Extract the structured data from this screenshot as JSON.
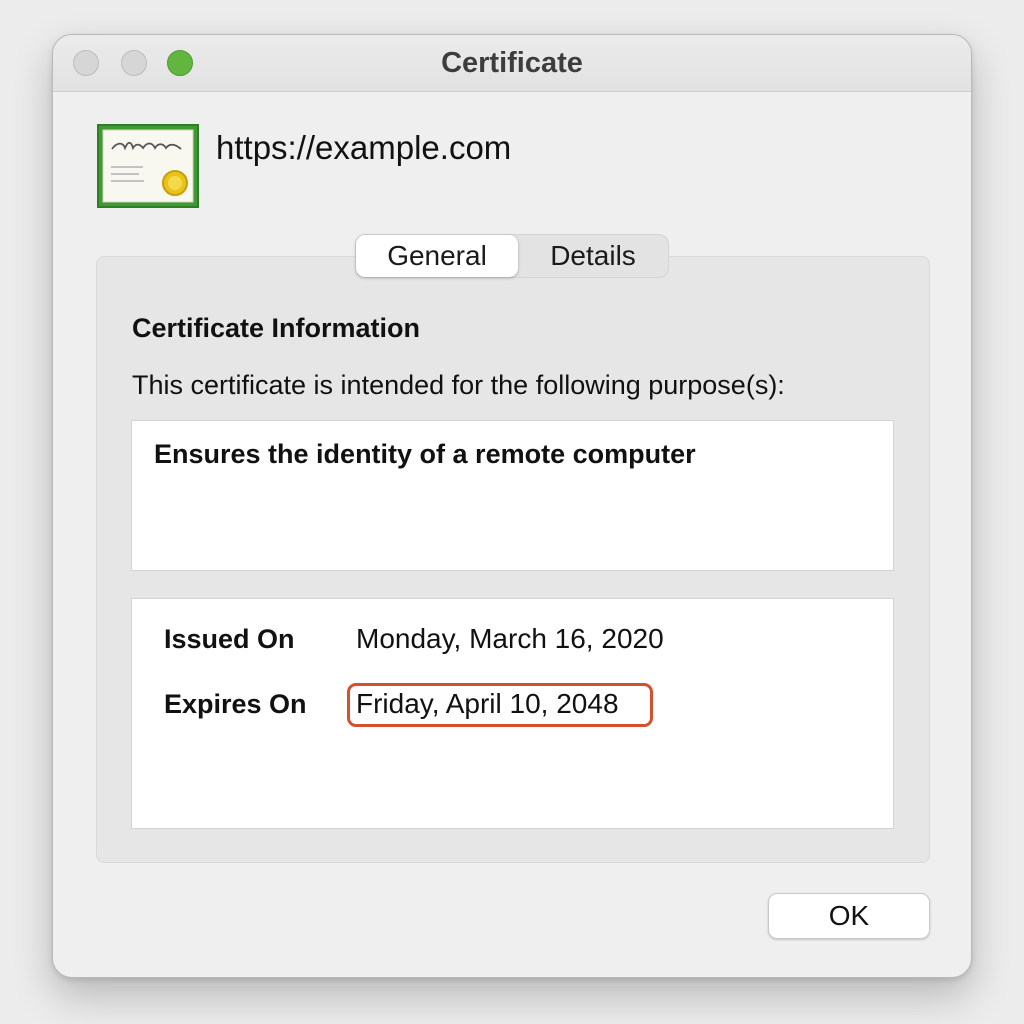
{
  "window": {
    "title": "Certificate"
  },
  "header": {
    "icon": "certificate-icon",
    "site_url": "https://example.com"
  },
  "tabs": [
    {
      "label": "General",
      "selected": true
    },
    {
      "label": "Details",
      "selected": false
    }
  ],
  "general": {
    "heading": "Certificate Information",
    "purpose_intro": "This certificate is intended for the following purpose(s):",
    "purposes": [
      "Ensures the identity of a remote computer"
    ],
    "issued_label": "Issued On",
    "issued_value": "Monday, March 16, 2020",
    "expires_label": "Expires On",
    "expires_value": "Friday, April 10, 2048"
  },
  "footer": {
    "ok_label": "OK"
  },
  "colors": {
    "zoom_button": "#62b53f",
    "highlight_border": "#d5502d",
    "certificate_green": "#3f9a34",
    "certificate_seal": "#e8c41a"
  }
}
